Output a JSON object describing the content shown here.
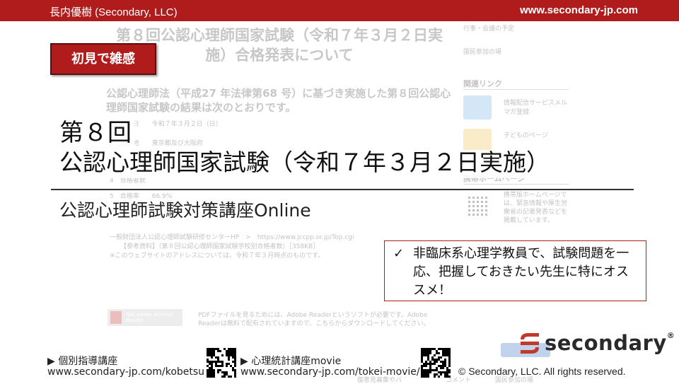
{
  "header": {
    "left_text": "長内優樹 (Secondary, LLC)",
    "right_url": "www.secondary-jp.com"
  },
  "background_page": {
    "heading": "第８回公認心理師国家試験（令和７年３月２日実施）合格発表について",
    "intro": "公認心理師法（平成27 年法律第68 号）に基づき実施した第８回公認心理師国家試験の結果は次のとおりです。",
    "row1": "1　試験日　　令和７年３月２日（日）",
    "row2": "2　試験地　　東京都及び大阪府",
    "row4": "4　合格者数",
    "row5": "5　合格率　　66.9%",
    "note_link_label": "一般財団法人公認心理師試験研修センターHP　>　https://www.jccpp.or.jp/Top.cgi",
    "pdf_link": "【参考資料】（第８回公認心理師国家試験学校別合格者数）［358KB］",
    "address_note": "※このウェブサイトのアドレスについては、令和７年３月時点のものです。",
    "pdf_note": "PDFファイルを見るためには、Adobe Readerというソフトが必要です。Adobe Readerは無料で配布されていますので、こちらからダウンロードしてください。",
    "pdf_badge": "Get Adobe Acrobat Reader",
    "side_item1": "行事・会議の予定",
    "side_item2": "国民参加の場",
    "side_heading": "関連リンク",
    "side_link1": "情報配信サービスメルマガ登録",
    "side_link2": "子どものページ",
    "side_heading2": "携帯ホームページ",
    "side_link3": "携帯版ホームページでは、緊急情報や厚生労働省の記者発表などを掲載しています。",
    "bottom_text1": "コメント",
    "bottom_text2": "国民参加の場",
    "bottom_text3": "御意見募集やパ"
  },
  "badge": {
    "label": "初見で雑感"
  },
  "title": {
    "line1": "第８回",
    "line2": "公認心理師国家試験（令和７年３月２日実施）",
    "subtitle": "公認心理師試験対策講座Online"
  },
  "callout": {
    "check": "✓",
    "text": "非臨床系心理学教員で、試験問題を一応、把握しておきたい先生に特にオススメ！"
  },
  "footer": {
    "course1_label": "▶ 個別指導講座",
    "course1_url": "www.secondary-jp.com/kobetsu",
    "course2_label": "▶ 心理統計講座movie",
    "course2_url": "www.secondary-jp.com/tokei-movie/",
    "copyright": "© Secondary, LLC. All rights reserved."
  },
  "logo": {
    "word": "secondary",
    "suffix": "®"
  },
  "colors": {
    "accent": "#b01c1c"
  }
}
